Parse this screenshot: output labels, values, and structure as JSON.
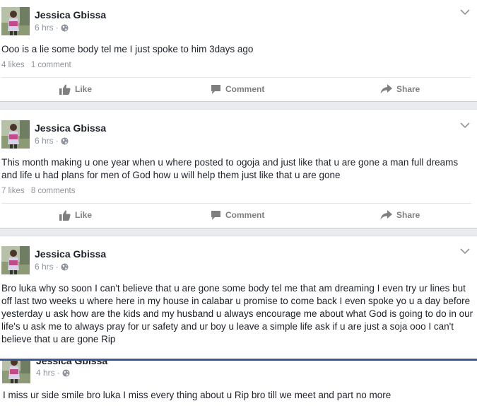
{
  "posts": [
    {
      "author": "Jessica Gbissa",
      "time": "6 hrs",
      "separator": "·",
      "text": "Ooo is a lie some body tel me I just spoke to him 3days ago",
      "likes": "4 likes",
      "comments": "1 comment"
    },
    {
      "author": "Jessica Gbissa",
      "time": "6 hrs",
      "separator": "·",
      "text": "This month making u one year when u where posted to ogoja and just like that u are gone a man full dreams and life u had plans for men of God how u will help them just like that u are gone",
      "likes": "7 likes",
      "comments": "8 comments"
    },
    {
      "author": "Jessica Gbissa",
      "time": "6 hrs",
      "separator": "·",
      "text": "Bro luka why so soon I can't believe that u are gone some body tel me that am dreaming I even try ur lines but off last two weeks u where here in my house in calabar u promise to come back I even spoke yo u a day before yesterday u ask how are the kids and my husband  u always encourage  me about what God is going to do in our life's u ask me to always pray for ur safety and ur boy u leave a simple life ask if u are just a soja ooo I can't believe that u are gone Rip"
    },
    {
      "author": "Jessica Gbissa",
      "time": "4 hrs",
      "separator": "·",
      "text": "I miss ur side smile bro luka I miss every thing  about u Rip bro till we meet and part no more"
    }
  ],
  "actions": {
    "like": "Like",
    "comment": "Comment",
    "share": "Share"
  },
  "icons": {
    "privacy": "globe-icon",
    "menu": "chevron-down-icon",
    "like": "thumbs-up-icon",
    "comment": "comment-icon",
    "share": "share-arrow-icon"
  },
  "colors": {
    "text": "#1d2129",
    "meta": "#90949c",
    "action": "#7f7f7f",
    "divider": "#e9ebee",
    "accent": "#3b5998"
  }
}
